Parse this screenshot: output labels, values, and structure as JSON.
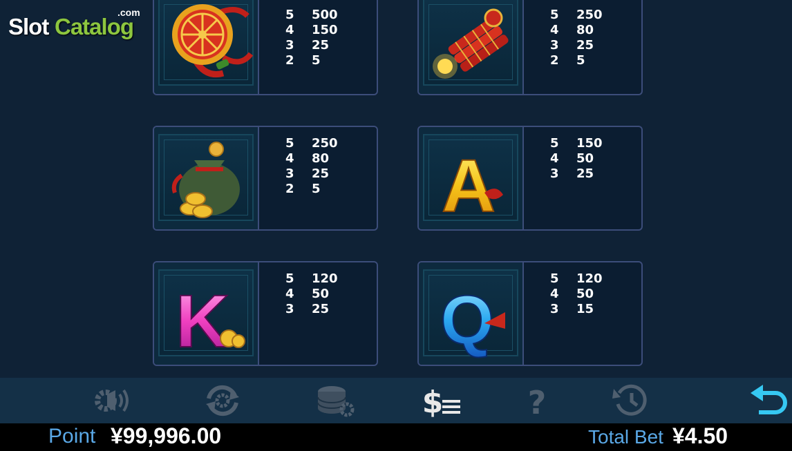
{
  "logo": {
    "part1": "Slot",
    "part2": "Catalog",
    "suffix": ".com"
  },
  "paytable": [
    {
      "symbol": "golden-wheel-ornament",
      "pays": [
        [
          "5",
          "500"
        ],
        [
          "4",
          "150"
        ],
        [
          "3",
          "25"
        ],
        [
          "2",
          "5"
        ]
      ]
    },
    {
      "symbol": "firecrackers",
      "pays": [
        [
          "5",
          "250"
        ],
        [
          "4",
          "80"
        ],
        [
          "3",
          "25"
        ],
        [
          "2",
          "5"
        ]
      ]
    },
    {
      "symbol": "money-bag-coins",
      "pays": [
        [
          "5",
          "250"
        ],
        [
          "4",
          "80"
        ],
        [
          "3",
          "25"
        ],
        [
          "2",
          "5"
        ]
      ]
    },
    {
      "symbol": "letter-a",
      "letter": "A",
      "pays": [
        [
          "5",
          "150"
        ],
        [
          "4",
          "50"
        ],
        [
          "3",
          "25"
        ]
      ]
    },
    {
      "symbol": "letter-k",
      "letter": "K",
      "pays": [
        [
          "5",
          "120"
        ],
        [
          "4",
          "50"
        ],
        [
          "3",
          "25"
        ]
      ]
    },
    {
      "symbol": "letter-q",
      "letter": "Q",
      "pays": [
        [
          "5",
          "120"
        ],
        [
          "4",
          "50"
        ],
        [
          "3",
          "15"
        ]
      ]
    }
  ],
  "toolbar": {
    "icons": [
      "sound-settings-icon",
      "autoplay-icon",
      "chips-bet-settings-icon",
      "paytable-icon",
      "help-icon",
      "history-icon",
      "back-icon"
    ],
    "colors": {
      "inactive": "#4f5f6f",
      "active": "#e8e8e8",
      "back": "#36c8f2"
    }
  },
  "status": {
    "point_label": "Point",
    "point_value": "¥99,996.00",
    "bet_label": "Total Bet",
    "bet_value": "¥4.50"
  }
}
